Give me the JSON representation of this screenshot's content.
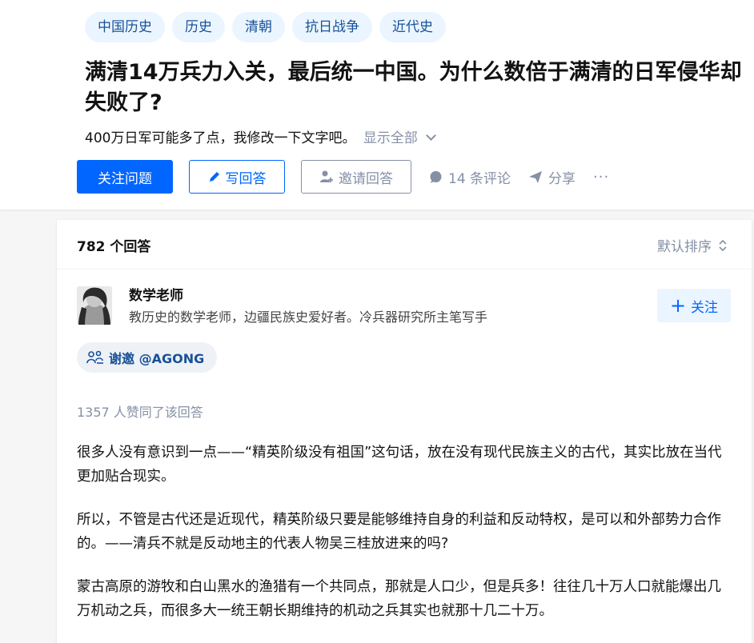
{
  "topics": [
    "中国历史",
    "历史",
    "清朝",
    "抗日战争",
    "近代史"
  ],
  "question": {
    "title": "满清14万兵力入关，最后统一中国。为什么数倍于满清的日军侵华却失败了?",
    "detail": "400万日军可能多了点，我修改一下文字吧。",
    "show_all": "显示全部"
  },
  "actions": {
    "follow": "关注问题",
    "write": "写回答",
    "invite": "邀请回答",
    "comments": "14 条评论",
    "share": "分享",
    "more": "···"
  },
  "answers": {
    "count_label": "782 个回答",
    "sort_label": "默认排序"
  },
  "author": {
    "name": "数学老师",
    "bio": "教历史的数学老师，边疆民族史爱好者。冷兵器研究所主笔写手",
    "follow_label": "关注"
  },
  "invite_tag": "谢邀 @AGONG",
  "votes_text": "1357 人赞同了该回答",
  "paragraphs": [
    "很多人没有意识到一点——“精英阶级没有祖国”这句话，放在没有现代民族主义的古代，其实比放在当代更加贴合现实。",
    "所以，不管是古代还是近现代，精英阶级只要是能够维持自身的利益和反动特权，是可以和外部势力合作的。——清兵不就是反动地主的代表人物吴三桂放进来的吗?",
    "蒙古高原的游牧和白山黑水的渔猎有一个共同点，那就是人口少，但是兵多！往往几十万人口就能爆出几万机动之兵，而很多大一统王朝长期维持的机动之兵其实也就那十几二十万。"
  ],
  "colors": {
    "accent": "#0066ff",
    "topic_bg": "#ebf5ff",
    "topic_text": "#175199",
    "muted": "#8590a6"
  }
}
